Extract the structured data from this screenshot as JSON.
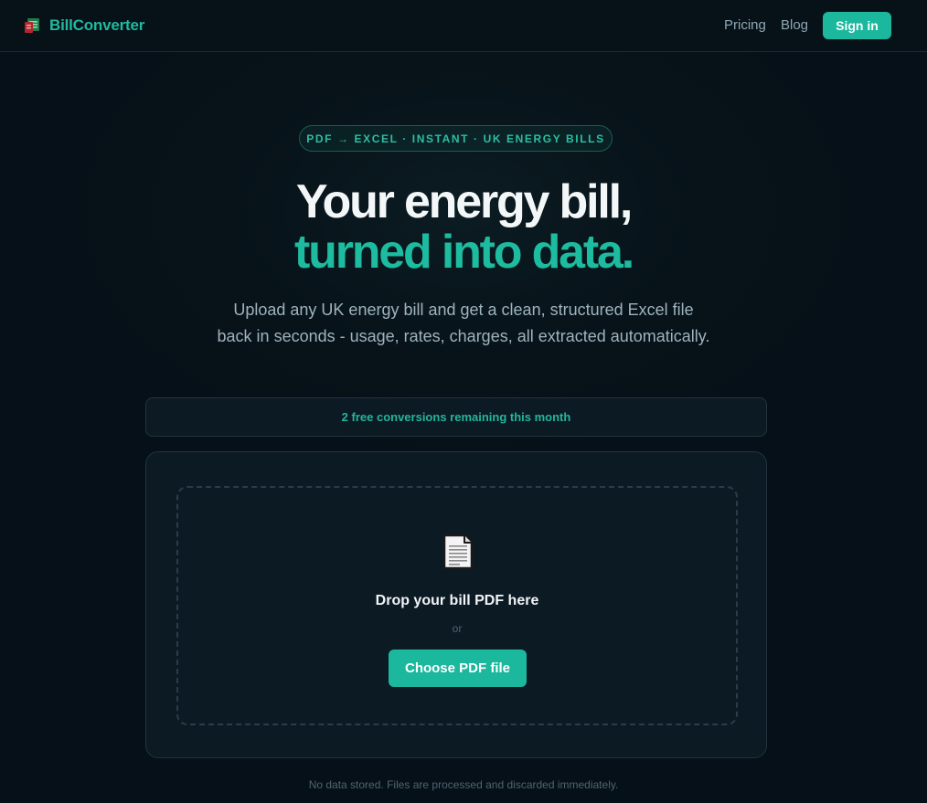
{
  "header": {
    "brand_name": "BillConverter",
    "brand_icon": "spreadsheet-icon",
    "nav": [
      {
        "label": "Pricing"
      },
      {
        "label": "Blog"
      }
    ],
    "signin_label": "Sign in"
  },
  "hero": {
    "pill_text": "PDF → EXCEL · INSTANT · UK ENERGY BILLS",
    "title_line1": "Your energy bill,",
    "title_line2": "turned into data.",
    "subtitle": "Upload any UK energy bill and get a clean, structured Excel file back in seconds - usage, rates, charges, all extracted automatically."
  },
  "banner": {
    "text": "2 free conversions remaining this month"
  },
  "upload": {
    "icon": "document-icon",
    "drop_title": "Drop your bill PDF here",
    "or_text": "or",
    "choose_label": "Choose PDF file"
  },
  "footer": {
    "note": "No data stored. Files are processed and discarded immediately."
  },
  "colors": {
    "accent": "#1bb89e",
    "background": "#061018",
    "card": "#0c1a24"
  }
}
